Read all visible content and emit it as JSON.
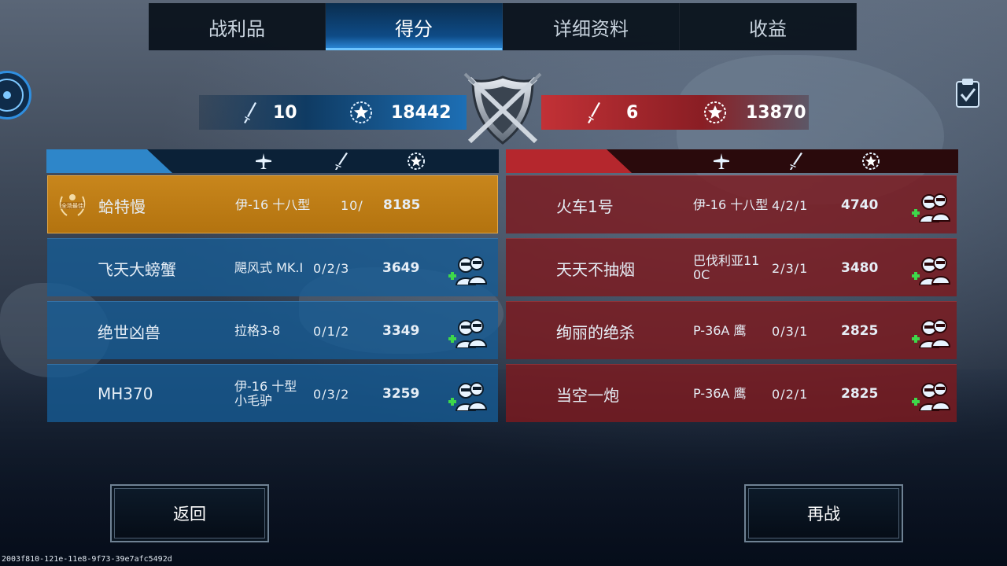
{
  "tabs": [
    {
      "label": "战利品"
    },
    {
      "label": "得分"
    },
    {
      "label": "详细资料"
    },
    {
      "label": "收益"
    }
  ],
  "active_tab": 1,
  "score_summary": {
    "left": {
      "kills": "10",
      "points": "18442"
    },
    "right": {
      "kills": "6",
      "points": "13870"
    }
  },
  "team_left": [
    {
      "name": "蛤特慢",
      "plane": "伊-16 十八型",
      "kda": "10/",
      "score": "8185",
      "highlight": true,
      "medal_text": "全场最佳",
      "friend_button": false
    },
    {
      "name": "飞天大螃蟹",
      "plane": "飓风式 MK.I",
      "kda": "0/2/3",
      "score": "3649",
      "highlight": false,
      "friend_button": true
    },
    {
      "name": "绝世凶兽",
      "plane": "拉格3-8",
      "kda": "0/1/2",
      "score": "3349",
      "highlight": false,
      "friend_button": true
    },
    {
      "name": "MH370",
      "plane": "伊-16 十型\n小毛驴",
      "kda": "0/3/2",
      "score": "3259",
      "highlight": false,
      "friend_button": true
    }
  ],
  "team_right": [
    {
      "name": "火车1号",
      "plane": "伊-16 十八型",
      "kda": "4/2/1",
      "score": "4740",
      "friend_button": true
    },
    {
      "name": "天天不抽烟",
      "plane": "巴伐利亚11\n0C",
      "kda": "2/3/1",
      "score": "3480",
      "friend_button": true
    },
    {
      "name": "绚丽的绝杀",
      "plane": "P-36A 鹰",
      "kda": "0/3/1",
      "score": "2825",
      "friend_button": true
    },
    {
      "name": "当空一炮",
      "plane": "P-36A 鹰",
      "kda": "0/2/1",
      "score": "2825",
      "friend_button": true
    }
  ],
  "buttons": {
    "back": "返回",
    "rematch": "再战"
  },
  "session_id": "2003f810-121e-11e8-9f73-39e7afc5492d",
  "colors": {
    "blue_team": "#1d6fb5",
    "red_team": "#b5272d",
    "gold": "#c8861c",
    "tab_active": "#0e4b86"
  },
  "icons": {
    "header": [
      "plane-icon",
      "sword-icon",
      "star-laurel-icon"
    ],
    "friend": "add-friend-icon",
    "emblem": "crossed-swords-shield-icon",
    "clipboard": "clipboard-check-icon"
  }
}
